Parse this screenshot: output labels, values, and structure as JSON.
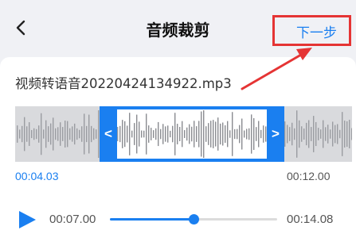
{
  "header": {
    "title": "音频裁剪",
    "next_label": "下一步"
  },
  "file": {
    "name": "视频转语音20220424134922.mp3"
  },
  "trim": {
    "start_label": "00:04.03",
    "end_label": "00:12.00",
    "left_handle_glyph": "<",
    "right_handle_glyph": ">"
  },
  "player": {
    "current_time": "00:07.00",
    "total_time": "00:14.08",
    "progress": 0.5
  },
  "colors": {
    "accent": "#1a7ff0",
    "highlight_box": "#e53434",
    "waveform_inactive": "#9a9ca1",
    "waveform_active": "#8a8c91"
  },
  "icons": {
    "back": "chevron-left-icon",
    "play": "play-icon",
    "annotation": "red-arrow"
  }
}
